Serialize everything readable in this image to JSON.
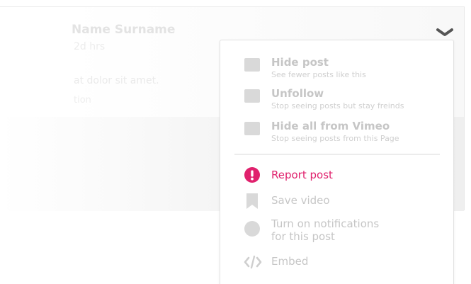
{
  "post": {
    "author_name": "Name Surname",
    "time": "2d hrs",
    "text_line1": "at dolor sit amet.",
    "text_line2": "tion"
  },
  "menu": {
    "hide_options": [
      {
        "title": "Hide post",
        "subtitle": "See fewer posts like this"
      },
      {
        "title": "Unfollow",
        "subtitle": "Stop seeing posts but stay freinds"
      },
      {
        "title": "Hide all from Vimeo",
        "subtitle": "Stop seeing posts from this Page"
      }
    ],
    "actions": {
      "report": "Report post",
      "save": "Save video",
      "notify_line1": "Turn on notifications",
      "notify_line2": "for this post",
      "embed": "Embed"
    }
  },
  "icons": {
    "menu_toggle": "chevron-down-icon",
    "report": "exclamation-circle-icon",
    "save": "bookmark-icon",
    "notify": "circle-icon",
    "embed": "code-icon"
  },
  "colors": {
    "accent": "#e0216d",
    "muted_text": "#c6c6c6",
    "placeholder_box": "#d9d9d9",
    "chevron": "#555555"
  }
}
